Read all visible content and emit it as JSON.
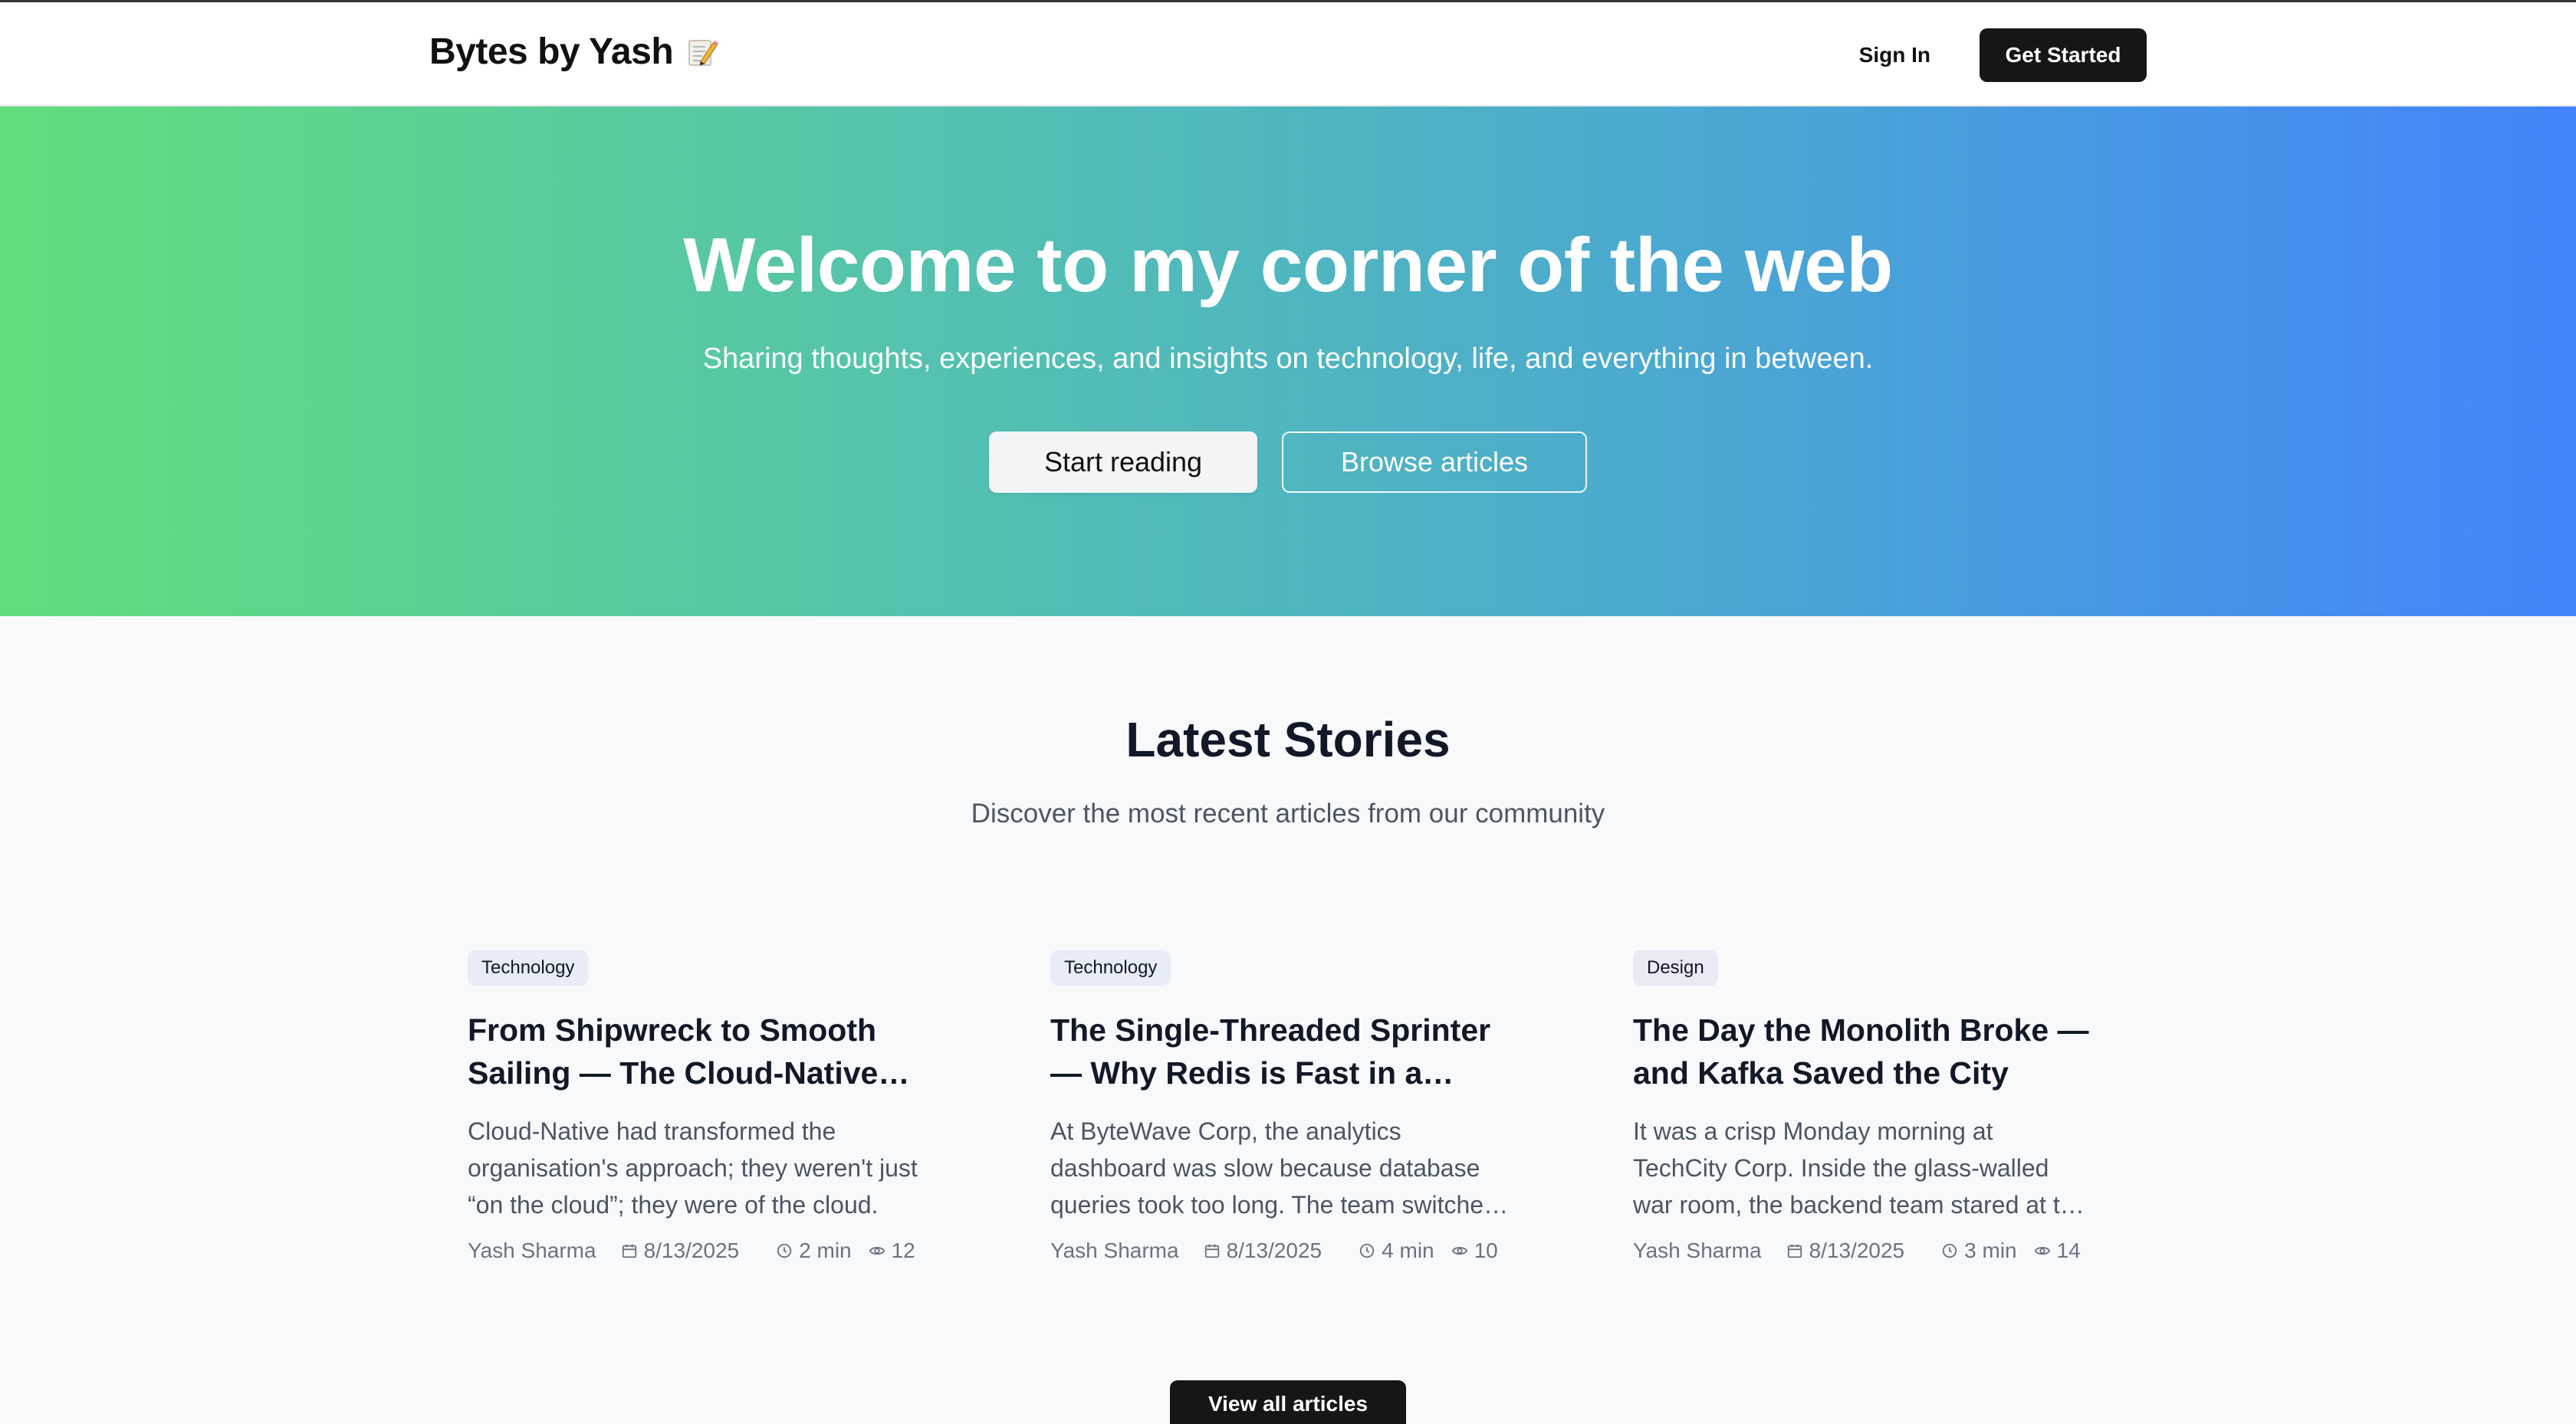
{
  "nav": {
    "brand": "Bytes by Yash",
    "brand_icon": "memo-pencil-icon",
    "sign_in": "Sign In",
    "get_started": "Get Started"
  },
  "hero": {
    "title": "Welcome to my corner of the web",
    "subtitle": "Sharing thoughts, experiences, and insights on technology, life, and everything in between.",
    "start_reading": "Start reading",
    "browse_articles": "Browse articles",
    "gradient_start": "#62dd7c",
    "gradient_end": "#4483fb"
  },
  "latest": {
    "title": "Latest Stories",
    "subtitle": "Discover the most recent articles from our community",
    "view_all": "View all articles"
  },
  "articles": [
    {
      "category": "Technology",
      "title": "From Shipwreck to Smooth Sailing — The Cloud-Native Journey",
      "excerpt": "Cloud-Native had transformed the organisation's approach; they weren't just “on the cloud”; they were of the cloud.",
      "author": "Yash Sharma",
      "date": "8/13/2025",
      "read_time": "2 min",
      "views": "12"
    },
    {
      "category": "Technology",
      "title": "The Single-Threaded Sprinter — Why Redis is Fast in a Multi-Threaded World",
      "excerpt": "At ByteWave Corp, the analytics dashboard was slow because database queries took too long. The team switched to Redis.",
      "author": "Yash Sharma",
      "date": "8/13/2025",
      "read_time": "4 min",
      "views": "10"
    },
    {
      "category": "Design",
      "title": "The Day the Monolith Broke — and Kafka Saved the City",
      "excerpt": "It was a crisp Monday morning at TechCity Corp. Inside the glass-walled war room, the backend team stared at the screens.",
      "author": "Yash Sharma",
      "date": "8/13/2025",
      "read_time": "3 min",
      "views": "14"
    }
  ]
}
